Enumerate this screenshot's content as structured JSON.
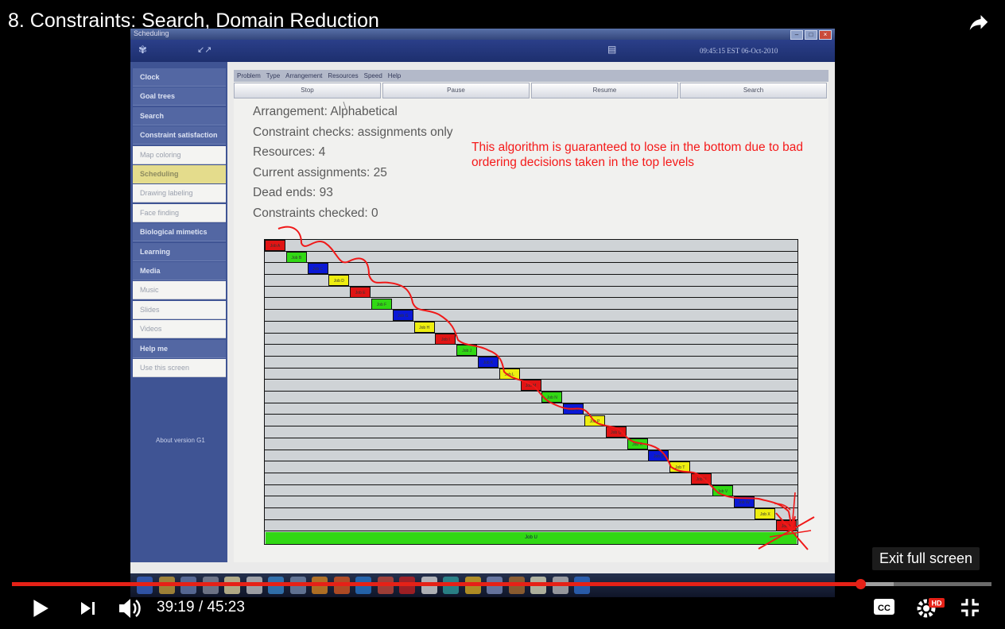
{
  "video": {
    "title": "8. Constraints: Search, Domain Reduction",
    "time_current": "39:19",
    "time_total": "45:23",
    "time_sep": " / ",
    "progress_played": 0.866,
    "progress_buffered": 0.9,
    "exit_fullscreen_tooltip": "Exit full screen",
    "cc_label": "CC",
    "hd_badge": "HD"
  },
  "app": {
    "window_title": "Scheduling",
    "clock": "09:45:15 EST 06-Oct-2010",
    "sidebar": [
      {
        "label": "Clock",
        "kind": "hdr"
      },
      {
        "label": "Goal trees",
        "kind": "hdr"
      },
      {
        "label": "Search",
        "kind": "hdr"
      },
      {
        "label": "Constraint satisfaction",
        "kind": "hdr"
      },
      {
        "label": "Map coloring",
        "kind": "sub"
      },
      {
        "label": "Scheduling",
        "kind": "sel"
      },
      {
        "label": "Drawing labeling",
        "kind": "sub"
      },
      {
        "label": "Face finding",
        "kind": "sub"
      },
      {
        "label": "Biological mimetics",
        "kind": "hdr"
      },
      {
        "label": "Learning",
        "kind": "hdr"
      },
      {
        "label": "Media",
        "kind": "hdr"
      },
      {
        "label": "Music",
        "kind": "sub"
      },
      {
        "label": "Slides",
        "kind": "sub"
      },
      {
        "label": "Videos",
        "kind": "sub"
      },
      {
        "label": "Help me",
        "kind": "hdr"
      },
      {
        "label": "Use this screen",
        "kind": "sub"
      }
    ],
    "about": "About version G1",
    "menu": [
      "Problem",
      "Type",
      "Arrangement",
      "Resources",
      "Speed",
      "Help"
    ],
    "buttons": [
      "Stop",
      "Pause",
      "Resume",
      "Search"
    ],
    "info": [
      "Arrangement: Alphabetical",
      "Constraint checks: assignments only",
      "Resources: 4",
      "Current assignments: 25",
      "Dead ends: 93",
      "Constraints checked: 0"
    ],
    "annotation": "This algorithm is guaranteed to lose in the bottom due to bad ordering decisions taken in the top levels",
    "colors": {
      "red": "#e01414",
      "green": "#31d814",
      "blue": "#0a18d6",
      "yellow": "#eeee10"
    },
    "grid_row_count": 25,
    "assignment_colors": [
      "red",
      "green",
      "blue",
      "yellow",
      "red",
      "green",
      "blue",
      "yellow",
      "red",
      "green",
      "blue",
      "yellow",
      "red",
      "green",
      "blue",
      "yellow",
      "red",
      "green",
      "blue",
      "yellow",
      "red",
      "green",
      "blue",
      "yellow",
      "red"
    ]
  }
}
